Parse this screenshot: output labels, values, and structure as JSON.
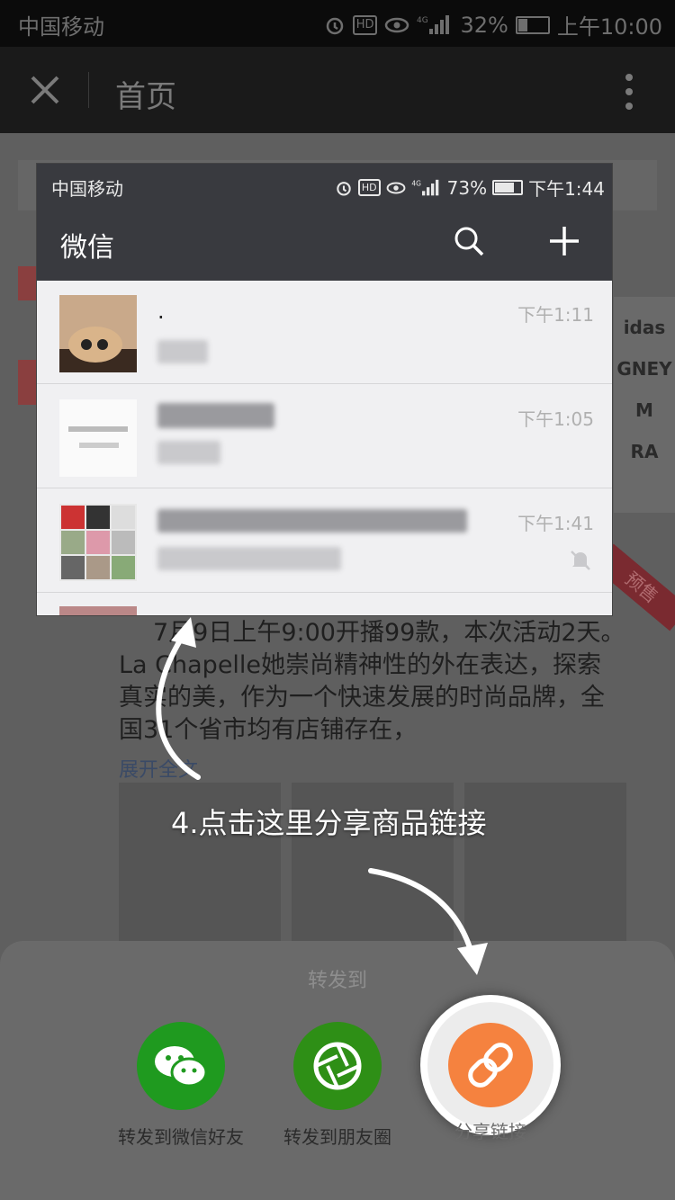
{
  "outer_status": {
    "carrier": "中国移动",
    "network": "4G",
    "battery": "32%",
    "time": "上午10:00"
  },
  "outer_nav": {
    "title": "首页"
  },
  "background_page": {
    "presale_badge": "预售",
    "description": {
      "line1": "7月9日上午9:00开播99款，本次活动2天。",
      "line2": "La Chapelle她崇尚精神性的外在表达，探索",
      "line3": "真实的美，作为一个快速发展的时尚品牌，全",
      "line4": "国31个省市均有店铺存在，"
    },
    "expand_link": "展开全文",
    "brands": [
      "idas",
      "GNEY",
      "M",
      "RA"
    ]
  },
  "embedded_screenshot": {
    "status": {
      "carrier": "中国移动",
      "battery": "73%",
      "time": "下午1:44"
    },
    "nav": {
      "title": "微信"
    },
    "chats": [
      {
        "name": ".",
        "time": "下午1:11"
      },
      {
        "name": "",
        "time": "下午1:05"
      },
      {
        "name": "",
        "time": "下午1:41",
        "muted": true
      }
    ]
  },
  "instruction": "4.点击这里分享商品链接",
  "share_sheet": {
    "title": "转发到",
    "items": [
      {
        "label": "转发到微信好友",
        "color": "#1f9a1f",
        "icon": "wechat-icon"
      },
      {
        "label": "转发到朋友圈",
        "color": "#2e8f16",
        "icon": "moments-icon"
      },
      {
        "label": "分享链接",
        "color": "#f5823f",
        "icon": "link-icon"
      }
    ]
  }
}
